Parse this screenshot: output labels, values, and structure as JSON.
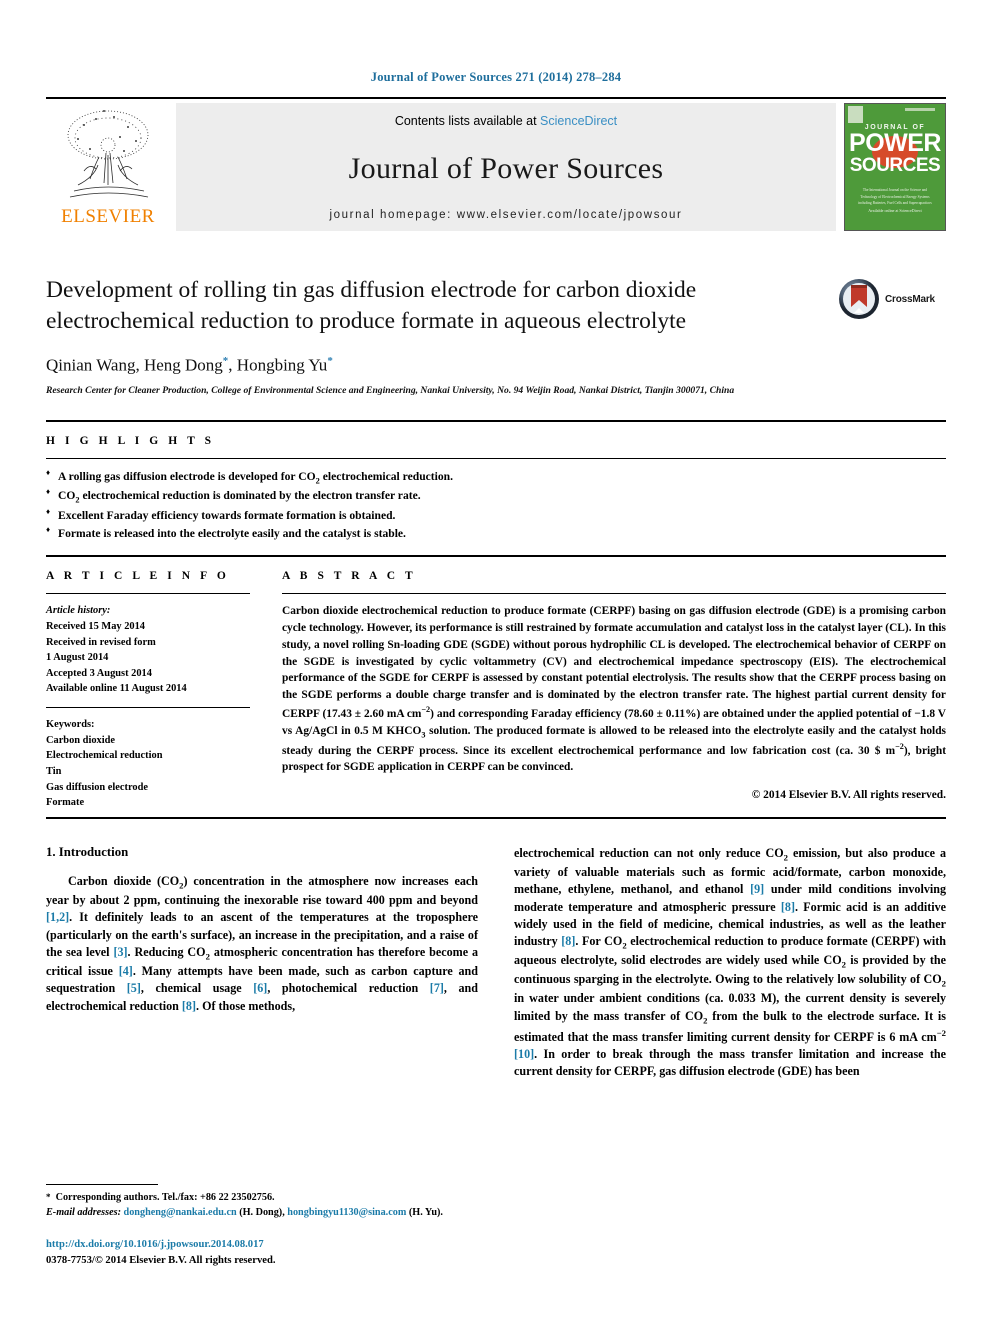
{
  "running_head": "Journal of Power Sources 271 (2014) 278–284",
  "masthead": {
    "contents_prefix": "Contents lists available at ",
    "sciencedirect": "ScienceDirect",
    "journal_name": "Journal of Power Sources",
    "homepage": "journal homepage: www.elsevier.com/locate/jpowsour",
    "publisher": "ELSEVIER",
    "cover": {
      "journal_of": "JOURNAL OF",
      "power": "POWER",
      "sources": "SOURCES",
      "blurb": "The International Journal on the Science and Technology of Electrochemical Energy Systems including Batteries, Fuel Cells and Supercapacitors",
      "footer": "Available online at\nScienceDirect"
    }
  },
  "article": {
    "title": "Development of rolling tin gas diffusion electrode for carbon dioxide electrochemical reduction to produce formate in aqueous electrolyte",
    "crossmark_label": "CrossMark",
    "authors_html": "Qinian Wang, Heng Dong<sup>*</sup>, Hongbing Yu<sup>*</sup>",
    "affiliation": "Research Center for Cleaner Production, College of Environmental Science and Engineering, Nankai University, No. 94 Weijin Road, Nankai District, Tianjin 300071, China"
  },
  "highlights": {
    "heading": "H I G H L I G H T S",
    "items_html": [
      "A rolling gas diffusion electrode is developed for CO<sub>2</sub> electrochemical reduction.",
      "CO<sub>2</sub> electrochemical reduction is dominated by the electron transfer rate.",
      "Excellent Faraday efficiency towards formate formation is obtained.",
      "Formate is released into the electrolyte easily and the catalyst is stable."
    ]
  },
  "article_info": {
    "heading": "A R T I C L E   I N F O",
    "history_label": "Article history:",
    "history_lines": [
      "Received 15 May 2014",
      "Received in revised form",
      "1 August 2014",
      "Accepted 3 August 2014",
      "Available online 11 August 2014"
    ],
    "keywords_label": "Keywords:",
    "keywords": [
      "Carbon dioxide",
      "Electrochemical reduction",
      "Tin",
      "Gas diffusion electrode",
      "Formate"
    ]
  },
  "abstract": {
    "heading": "A B S T R A C T",
    "text_html": "Carbon dioxide electrochemical reduction to produce formate (CERPF) basing on gas diffusion electrode (GDE) is a promising carbon cycle technology. However, its performance is still restrained by formate accumulation and catalyst loss in the catalyst layer (CL). In this study, a novel rolling Sn-loading GDE (SGDE) without porous hydrophilic CL is developed. The electrochemical behavior of CERPF on the SGDE is investigated by cyclic voltammetry (CV) and electrochemical impedance spectroscopy (EIS). The electrochemical performance of the SGDE for CERPF is assessed by constant potential electrolysis. The results show that the CERPF process basing on the SGDE performs a double charge transfer and is dominated by the electron transfer rate. The highest partial current density for CERPF (17.43 &#177; 2.60 mA cm<sup>&#8722;2</sup>) and corresponding Faraday efficiency (78.60 &#177; 0.11%) are obtained under the applied potential of &#8722;1.8 V vs Ag/AgCl in 0.5 M KHCO<sub>3</sub> solution. The produced formate is allowed to be released into the electrolyte easily and the catalyst holds steady during the CERPF process. Since its excellent electrochemical performance and low fabrication cost (ca. 30 $ m<sup>&#8722;2</sup>), bright prospect for SGDE application in CERPF can be convinced.",
    "copyright": "© 2014 Elsevier B.V. All rights reserved."
  },
  "body": {
    "section_number_title": "1.  Introduction",
    "left_para_html": "Carbon dioxide (CO<sub>2</sub>) concentration in the atmosphere now increases each year by about 2 ppm, continuing the inexorable rise toward 400 ppm and beyond <span class=\"ref\">[1,2]</span>. It definitely leads to an ascent of the temperatures at the troposphere (particularly on the earth's surface), an increase in the precipitation, and a raise of the sea level <span class=\"ref\">[3]</span>. Reducing CO<sub>2</sub> atmospheric concentration has therefore become a critical issue <span class=\"ref\">[4]</span>. Many attempts have been made, such as carbon capture and sequestration <span class=\"ref\">[5]</span>, chemical usage <span class=\"ref\">[6]</span>, photochemical reduction <span class=\"ref\">[7]</span>, and electrochemical reduction <span class=\"ref\">[8]</span>. Of those methods,",
    "right_para_html": "electrochemical reduction can not only reduce CO<sub>2</sub> emission, but also produce a variety of valuable materials such as formic acid/formate, carbon monoxide, methane, ethylene, methanol, and ethanol <span class=\"ref\">[9]</span> under mild conditions involving moderate temperature and atmospheric pressure <span class=\"ref\">[8]</span>. Formic acid is an additive widely used in the field of medicine, chemical industries, as well as the leather industry <span class=\"ref\">[8]</span>. For CO<sub>2</sub> electrochemical reduction to produce formate (CERPF) with aqueous electrolyte, solid electrodes are widely used while CO<sub>2</sub> is provided by the continuous sparging in the electrolyte. Owing to the relatively low solubility of CO<sub>2</sub> in water under ambient conditions (ca. 0.033 M), the current density is severely limited by the mass transfer of CO<sub>2</sub> from the bulk to the electrode surface. It is estimated that the mass transfer limiting current density for CERPF is 6 mA cm<sup>&#8722;2</sup> <span class=\"ref\">[10]</span>. In order to break through the mass transfer limitation and increase the current density for CERPF, gas diffusion electrode (GDE) has been"
  },
  "footnotes": {
    "corresponding_html": "<span class=\"star\">*</span>&nbsp; Corresponding authors. Tel./fax: +86 22 23502756.",
    "email_html": "<span class=\"fn-email\">E-mail addresses:</span> <span class=\"link\">dongheng@nankai.edu.cn</span> (H. Dong), <span class=\"link\">hongbingyu1130@sina.com</span> (H. Yu).",
    "doi": "http://dx.doi.org/10.1016/j.jpowsour.2014.08.017",
    "issn_line": "0378-7753/© 2014 Elsevier B.V. All rights reserved."
  },
  "colors": {
    "link": "#1b7ba8",
    "running_head": "#1e6e9c",
    "elsevier_orange": "#F08000",
    "cover_green": "#4e9a3a",
    "band_gray": "#ededed"
  }
}
